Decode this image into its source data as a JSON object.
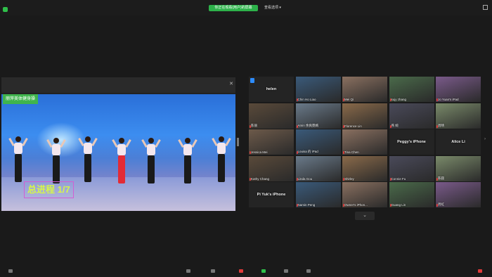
{
  "topbar": {
    "view_button_label": "你正在观看(用户)的屏幕",
    "view_options_label": "查看选项 ▾"
  },
  "share": {
    "brand_label": "丽萍美体健身操",
    "progress_label": "总进程 1/7"
  },
  "gallery": {
    "tiles": [
      {
        "name": "helen",
        "empty": true
      },
      {
        "name": "Chin Ho Liao"
      },
      {
        "name": "Mei Qi"
      },
      {
        "name": "sujy zhang"
      },
      {
        "name": "Jo Yuan's iPad"
      },
      {
        "name": "陈丽"
      },
      {
        "name": "Amin 余爽霓嫣"
      },
      {
        "name": "Florence Lin"
      },
      {
        "name": "燕 婉"
      },
      {
        "name": "周晴"
      },
      {
        "name": "Jessica Mei"
      },
      {
        "name": "Louisa 的 iPad"
      },
      {
        "name": "Tina Chen"
      },
      {
        "name": "Peggy's iPhone",
        "empty": true
      },
      {
        "name": "Alice Li",
        "empty": true
      },
      {
        "name": "Kathy Chang"
      },
      {
        "name": "Linda Gou"
      },
      {
        "name": "Shirley"
      },
      {
        "name": "Connie Fu"
      },
      {
        "name": "陈圆"
      },
      {
        "name": "Pi Yuk's iPhone",
        "empty": true
      },
      {
        "name": "Namin Peng"
      },
      {
        "name": "Owner's iPhon..."
      },
      {
        "name": "Guang Lin"
      },
      {
        "name": "周虹"
      }
    ],
    "more_glyph": "⌄"
  },
  "colors": {
    "accent_green": "#2db24a",
    "progress_text": "#d6f64a",
    "progress_border": "#d25fd3"
  }
}
